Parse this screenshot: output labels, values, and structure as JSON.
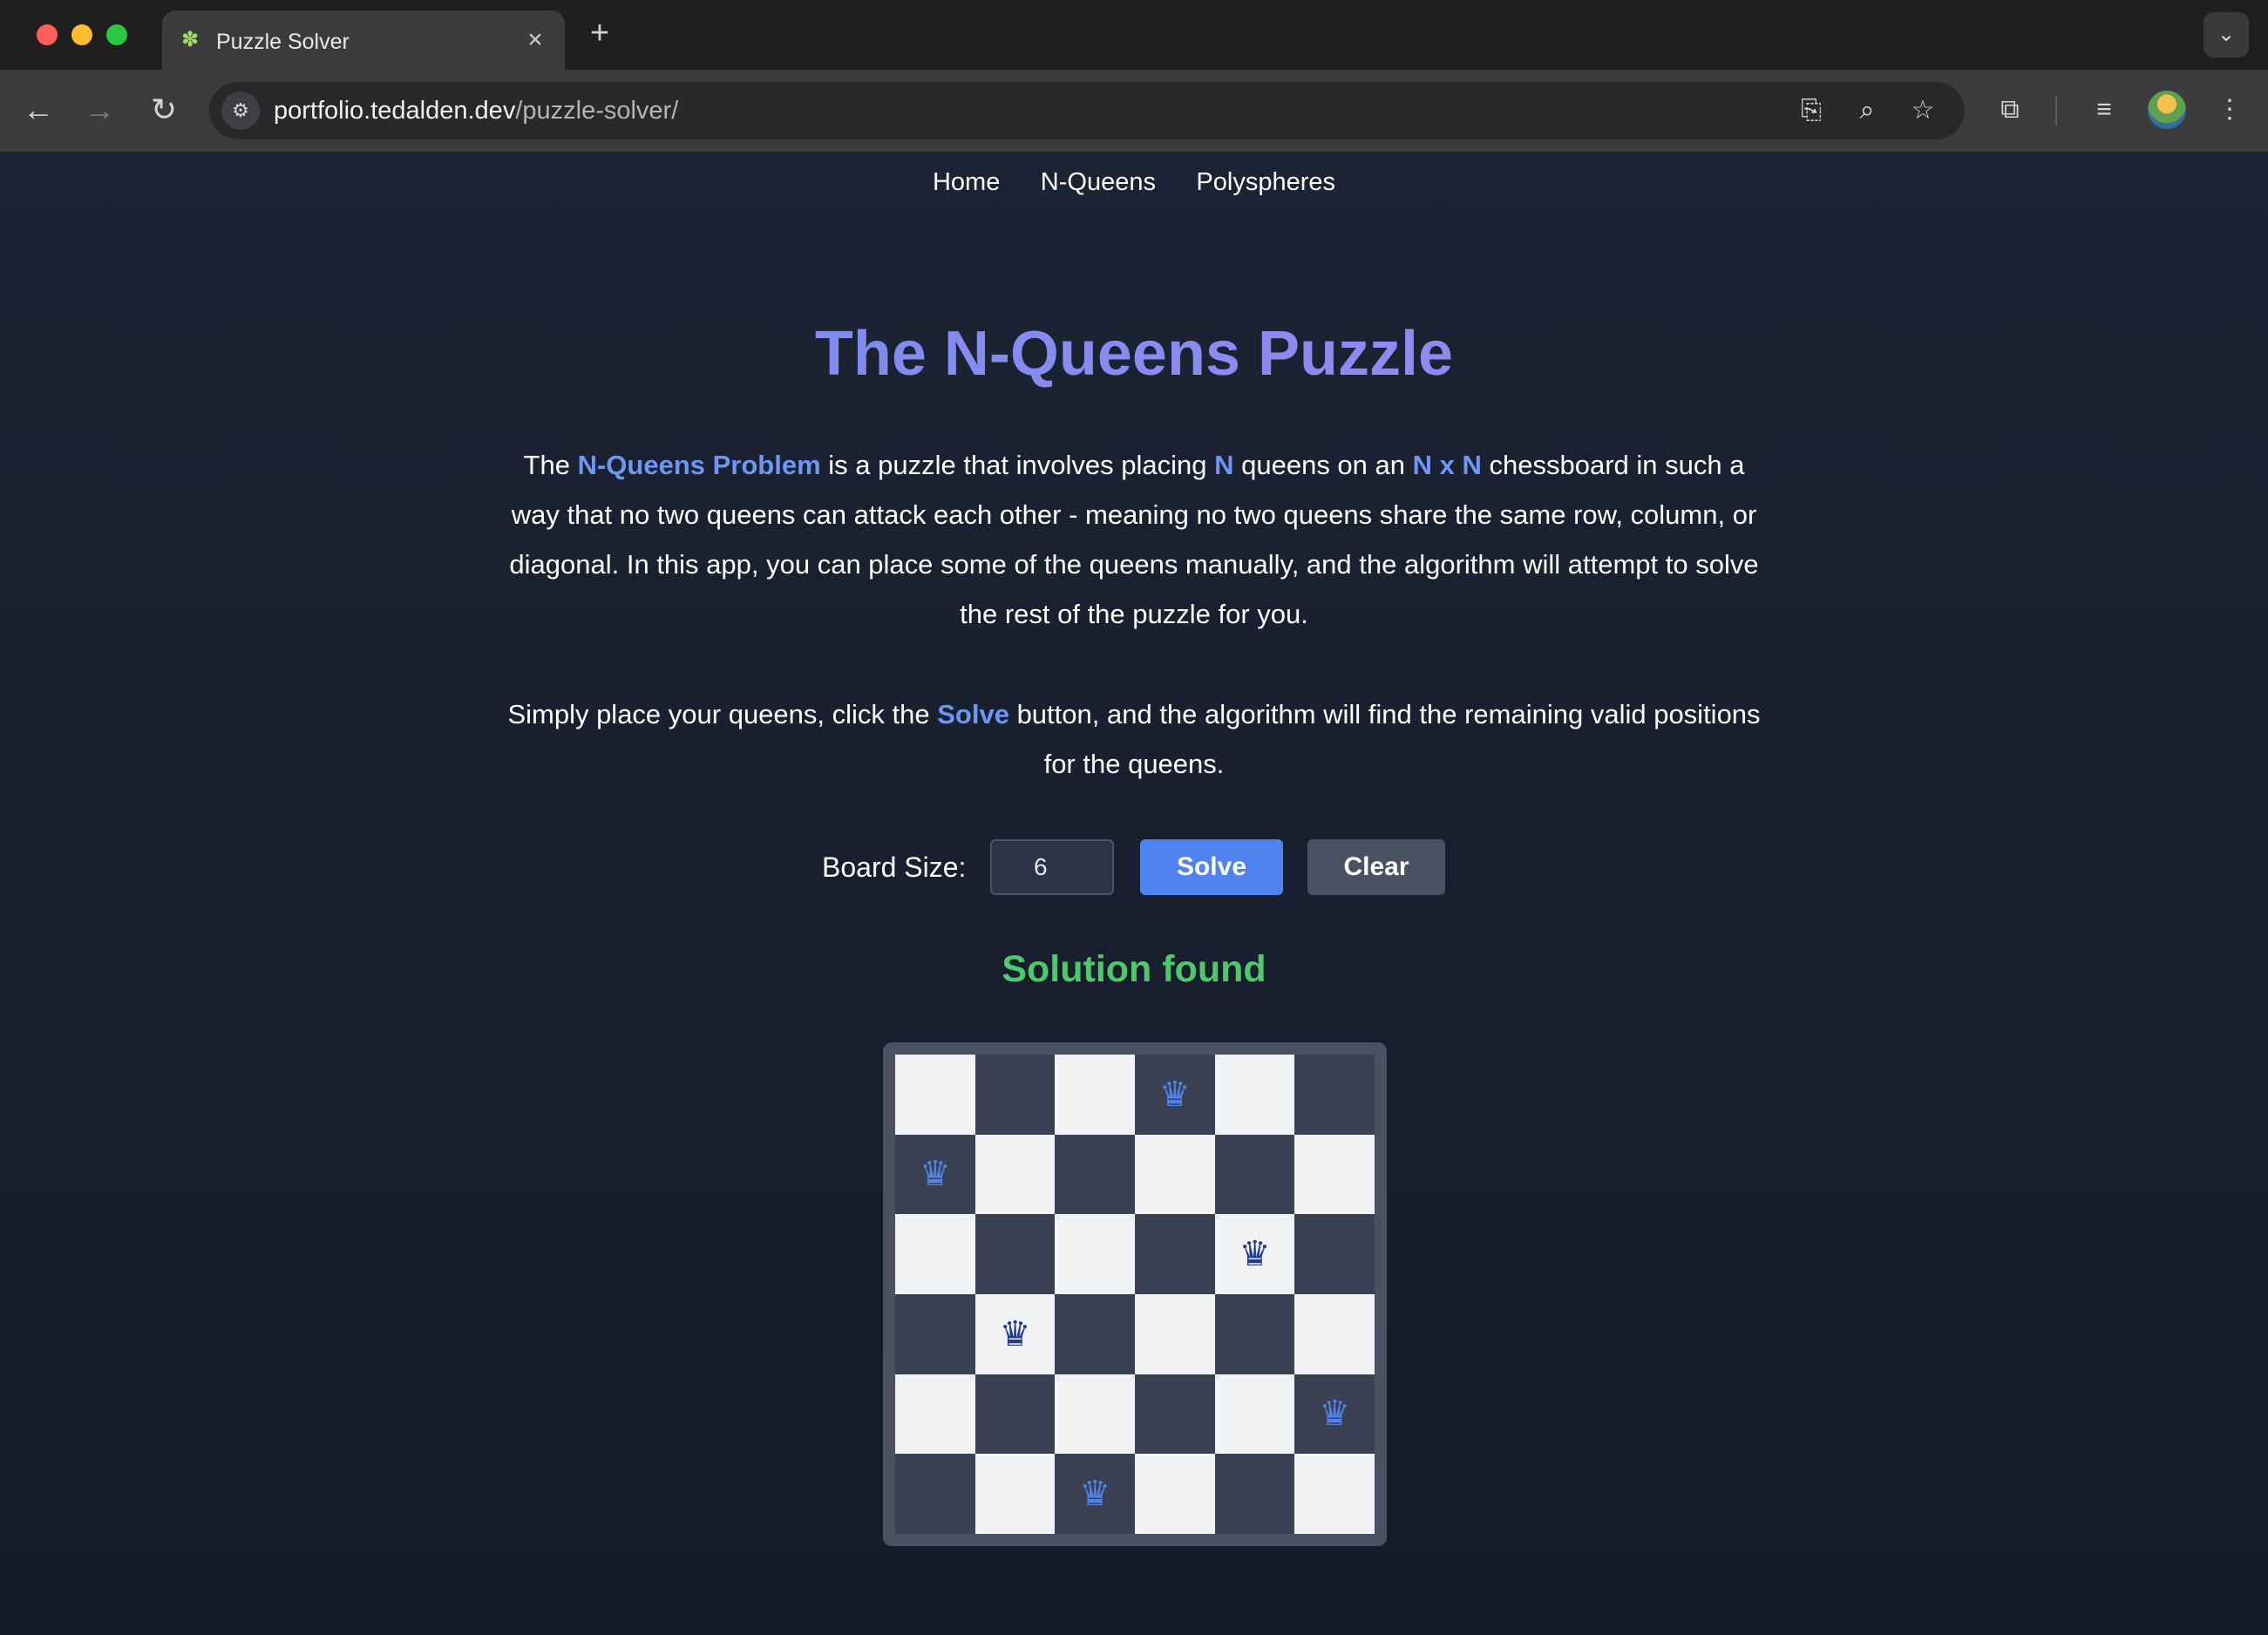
{
  "browser": {
    "tab_title": "Puzzle Solver",
    "url_host": "portfolio.tedalden.dev",
    "url_path": "/puzzle-solver/",
    "icons": [
      "back-arrow-icon",
      "forward-arrow-icon",
      "reload-icon",
      "site-info-icon",
      "install-icon",
      "zoom-icon",
      "bookmark-star-icon",
      "extensions-icon",
      "media-controls-icon",
      "kebab-menu-icon"
    ]
  },
  "nav": {
    "home": "Home",
    "nqueens": "N-Queens",
    "polyspheres": "Polyspheres"
  },
  "hero": {
    "title": "The N-Queens Puzzle"
  },
  "intro": {
    "t1": "The ",
    "h1": "N-Queens Problem",
    "t2": " is a puzzle that involves placing ",
    "h2": "N",
    "t3": " queens on an ",
    "h3": "N x N",
    "t4": " chessboard in such a way that no two queens can attack each other - meaning no two queens share the same row, column, or diagonal. In this app, you can place some of the queens manually, and the algorithm will attempt to solve the rest of the puzzle for you."
  },
  "instructions": {
    "t1": "Simply place your queens, click the ",
    "h1": "Solve",
    "t2": " button, and the algorithm will find the remaining valid positions for the queens."
  },
  "controls": {
    "board_size_label": "Board Size:",
    "board_size_value": "6",
    "solve_label": "Solve",
    "clear_label": "Clear"
  },
  "status": "Solution found",
  "board": {
    "size": 6,
    "queen_glyph": "♛",
    "colors": {
      "light": "#f1f2f4",
      "dark": "#3a4152",
      "user_queen": "#1f3b9a",
      "auto_queen": "#4f83f0"
    },
    "queens": [
      {
        "row": 0,
        "col": 3,
        "placed_by": "auto"
      },
      {
        "row": 1,
        "col": 0,
        "placed_by": "auto"
      },
      {
        "row": 2,
        "col": 4,
        "placed_by": "user"
      },
      {
        "row": 3,
        "col": 1,
        "placed_by": "user"
      },
      {
        "row": 4,
        "col": 5,
        "placed_by": "auto"
      },
      {
        "row": 5,
        "col": 2,
        "placed_by": "auto"
      }
    ]
  }
}
